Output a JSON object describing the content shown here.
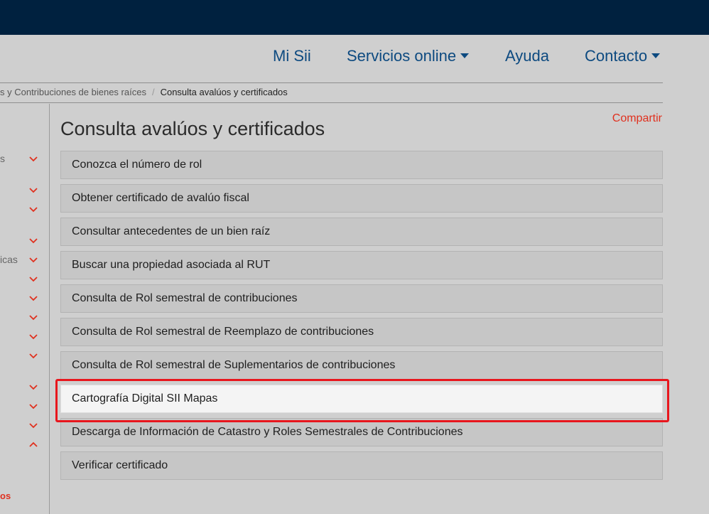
{
  "nav": {
    "items": [
      {
        "label": "Mi Sii",
        "dropdown": false
      },
      {
        "label": "Servicios online",
        "dropdown": true
      },
      {
        "label": "Ayuda",
        "dropdown": false
      },
      {
        "label": "Contacto",
        "dropdown": true
      }
    ]
  },
  "breadcrumb": {
    "parent": "s y Contribuciones de bienes raíces",
    "separator": "/",
    "current": "Consulta avalúos y certificados"
  },
  "sidebar": {
    "text_1": "s",
    "text_2": "icas",
    "text_3": "os",
    "chevron_color": "#e0301e"
  },
  "main": {
    "title": "Consulta avalúos y certificados",
    "share_label": "Compartir",
    "items": [
      "Conozca el número de rol",
      "Obtener certificado de avalúo fiscal",
      "Consultar antecedentes de un bien raíz",
      "Buscar una propiedad asociada al RUT",
      "Consulta de Rol semestral de contribuciones",
      "Consulta de Rol semestral de Reemplazo de contribuciones",
      "Consulta de Rol semestral de Suplementarios de contribuciones",
      "Cartografía Digital SII Mapas",
      "Descarga de Información de Catastro y Roles Semestrales de Contribuciones",
      "Verificar certificado"
    ],
    "active_item": "Cartografía Digital SII Mapas"
  },
  "colors": {
    "topbar": "#00213f",
    "nav_link": "#0d4a80",
    "accent_red": "#e0301e",
    "highlight_border": "#e8161d"
  }
}
